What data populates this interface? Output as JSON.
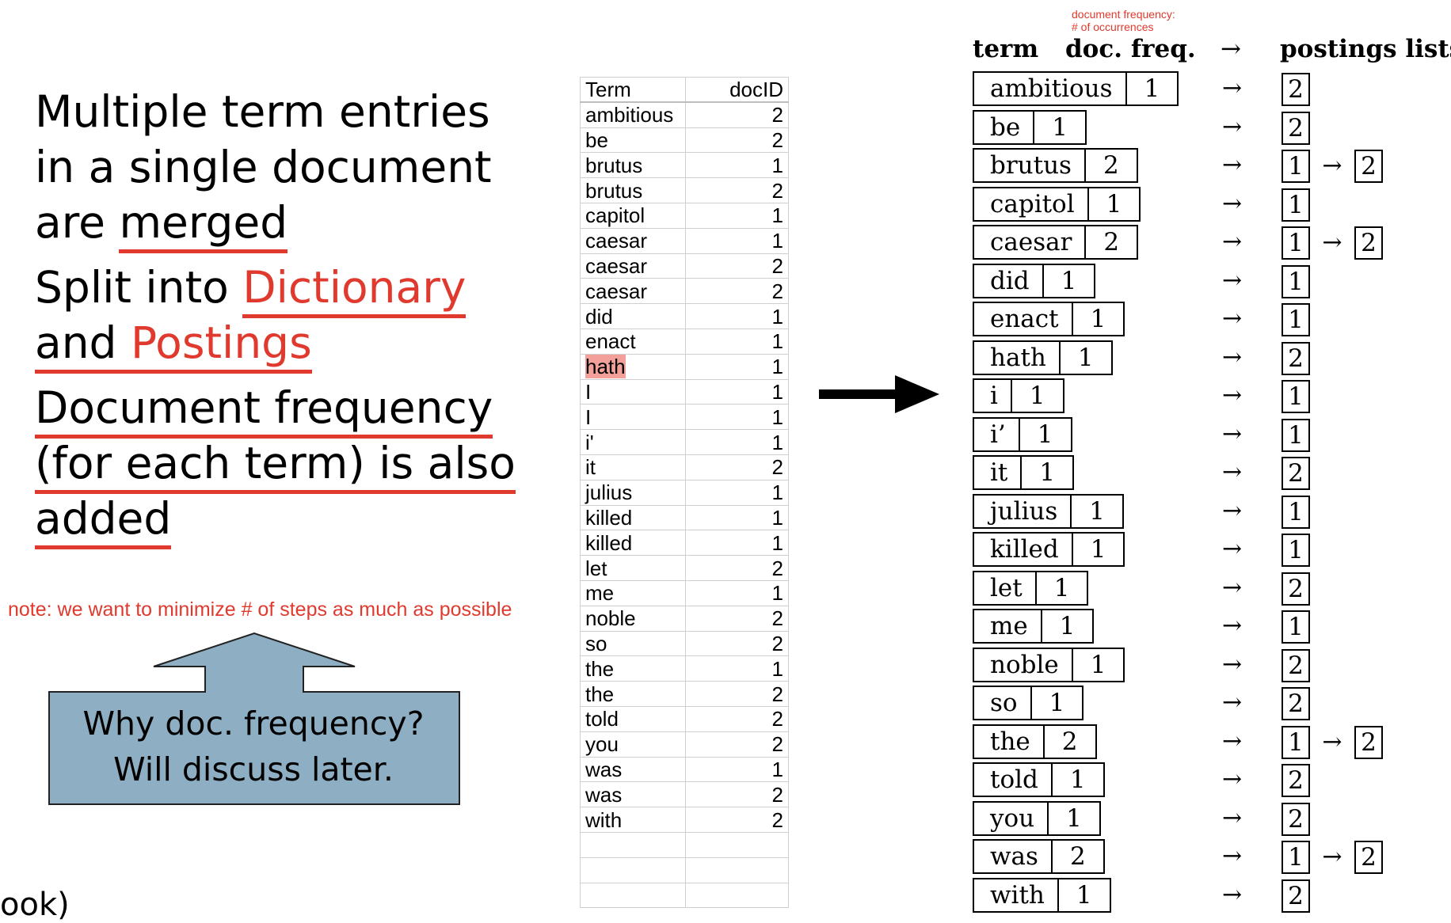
{
  "bullets": {
    "b1": {
      "l1": "Multiple term entries",
      "l2": "in a single document",
      "l3_pre": "are ",
      "l3_ul": "merged"
    },
    "b2": {
      "l1_pre": "Split into ",
      "l1_red": "Dictionary",
      "l2_pre": "and ",
      "l2_red": "Postings"
    },
    "b3": {
      "l1": "Document frequency",
      "l2": "(for each term) is also",
      "l3": "added"
    }
  },
  "note": "note: we want to minimize # of steps as much as possible",
  "callout": {
    "line1": "Why doc. frequency?",
    "line2": "Will discuss later.",
    "fill": "#8eaec3"
  },
  "cutoff_text": "ook)",
  "table": {
    "headers": [
      "Term",
      "docID"
    ],
    "rows": [
      [
        "ambitious",
        "2"
      ],
      [
        "be",
        "2"
      ],
      [
        "brutus",
        "1"
      ],
      [
        "brutus",
        "2"
      ],
      [
        "capitol",
        "1"
      ],
      [
        "caesar",
        "1"
      ],
      [
        "caesar",
        "2"
      ],
      [
        "caesar",
        "2"
      ],
      [
        "did",
        "1"
      ],
      [
        "enact",
        "1"
      ],
      [
        "hath",
        "1"
      ],
      [
        "I",
        "1"
      ],
      [
        "I",
        "1"
      ],
      [
        "i'",
        "1"
      ],
      [
        "it",
        "2"
      ],
      [
        "julius",
        "1"
      ],
      [
        "killed",
        "1"
      ],
      [
        "killed",
        "1"
      ],
      [
        "let",
        "2"
      ],
      [
        "me",
        "1"
      ],
      [
        "noble",
        "2"
      ],
      [
        "so",
        "2"
      ],
      [
        "the",
        "1"
      ],
      [
        "the",
        "2"
      ],
      [
        "told",
        "2"
      ],
      [
        "you",
        "2"
      ],
      [
        "was",
        "1"
      ],
      [
        "was",
        "2"
      ],
      [
        "with",
        "2"
      ],
      [
        "",
        ""
      ],
      [
        "",
        ""
      ],
      [
        "",
        ""
      ]
    ],
    "highlight_color": "#f2a099"
  },
  "dictionary": {
    "annotation_line1": "document frequency:",
    "annotation_line2": "# of occurrences",
    "header_term": "term",
    "header_freq": "doc. freq.",
    "header_arrow": "→",
    "header_postings": "postings lists",
    "arrow": "→",
    "entries": [
      {
        "term": "ambitious",
        "freq": "1",
        "postings": [
          "2"
        ]
      },
      {
        "term": "be",
        "freq": "1",
        "postings": [
          "2"
        ]
      },
      {
        "term": "brutus",
        "freq": "2",
        "postings": [
          "1",
          "2"
        ]
      },
      {
        "term": "capitol",
        "freq": "1",
        "postings": [
          "1"
        ]
      },
      {
        "term": "caesar",
        "freq": "2",
        "postings": [
          "1",
          "2"
        ]
      },
      {
        "term": "did",
        "freq": "1",
        "postings": [
          "1"
        ]
      },
      {
        "term": "enact",
        "freq": "1",
        "postings": [
          "1"
        ]
      },
      {
        "term": "hath",
        "freq": "1",
        "postings": [
          "2"
        ]
      },
      {
        "term": "i",
        "freq": "1",
        "postings": [
          "1"
        ]
      },
      {
        "term": "i’",
        "freq": "1",
        "postings": [
          "1"
        ]
      },
      {
        "term": "it",
        "freq": "1",
        "postings": [
          "2"
        ]
      },
      {
        "term": "julius",
        "freq": "1",
        "postings": [
          "1"
        ]
      },
      {
        "term": "killed",
        "freq": "1",
        "postings": [
          "1"
        ]
      },
      {
        "term": "let",
        "freq": "1",
        "postings": [
          "2"
        ]
      },
      {
        "term": "me",
        "freq": "1",
        "postings": [
          "1"
        ]
      },
      {
        "term": "noble",
        "freq": "1",
        "postings": [
          "2"
        ]
      },
      {
        "term": "so",
        "freq": "1",
        "postings": [
          "2"
        ]
      },
      {
        "term": "the",
        "freq": "2",
        "postings": [
          "1",
          "2"
        ]
      },
      {
        "term": "told",
        "freq": "1",
        "postings": [
          "2"
        ]
      },
      {
        "term": "you",
        "freq": "1",
        "postings": [
          "2"
        ]
      },
      {
        "term": "was",
        "freq": "2",
        "postings": [
          "1",
          "2"
        ]
      },
      {
        "term": "with",
        "freq": "1",
        "postings": [
          "2"
        ]
      }
    ]
  }
}
